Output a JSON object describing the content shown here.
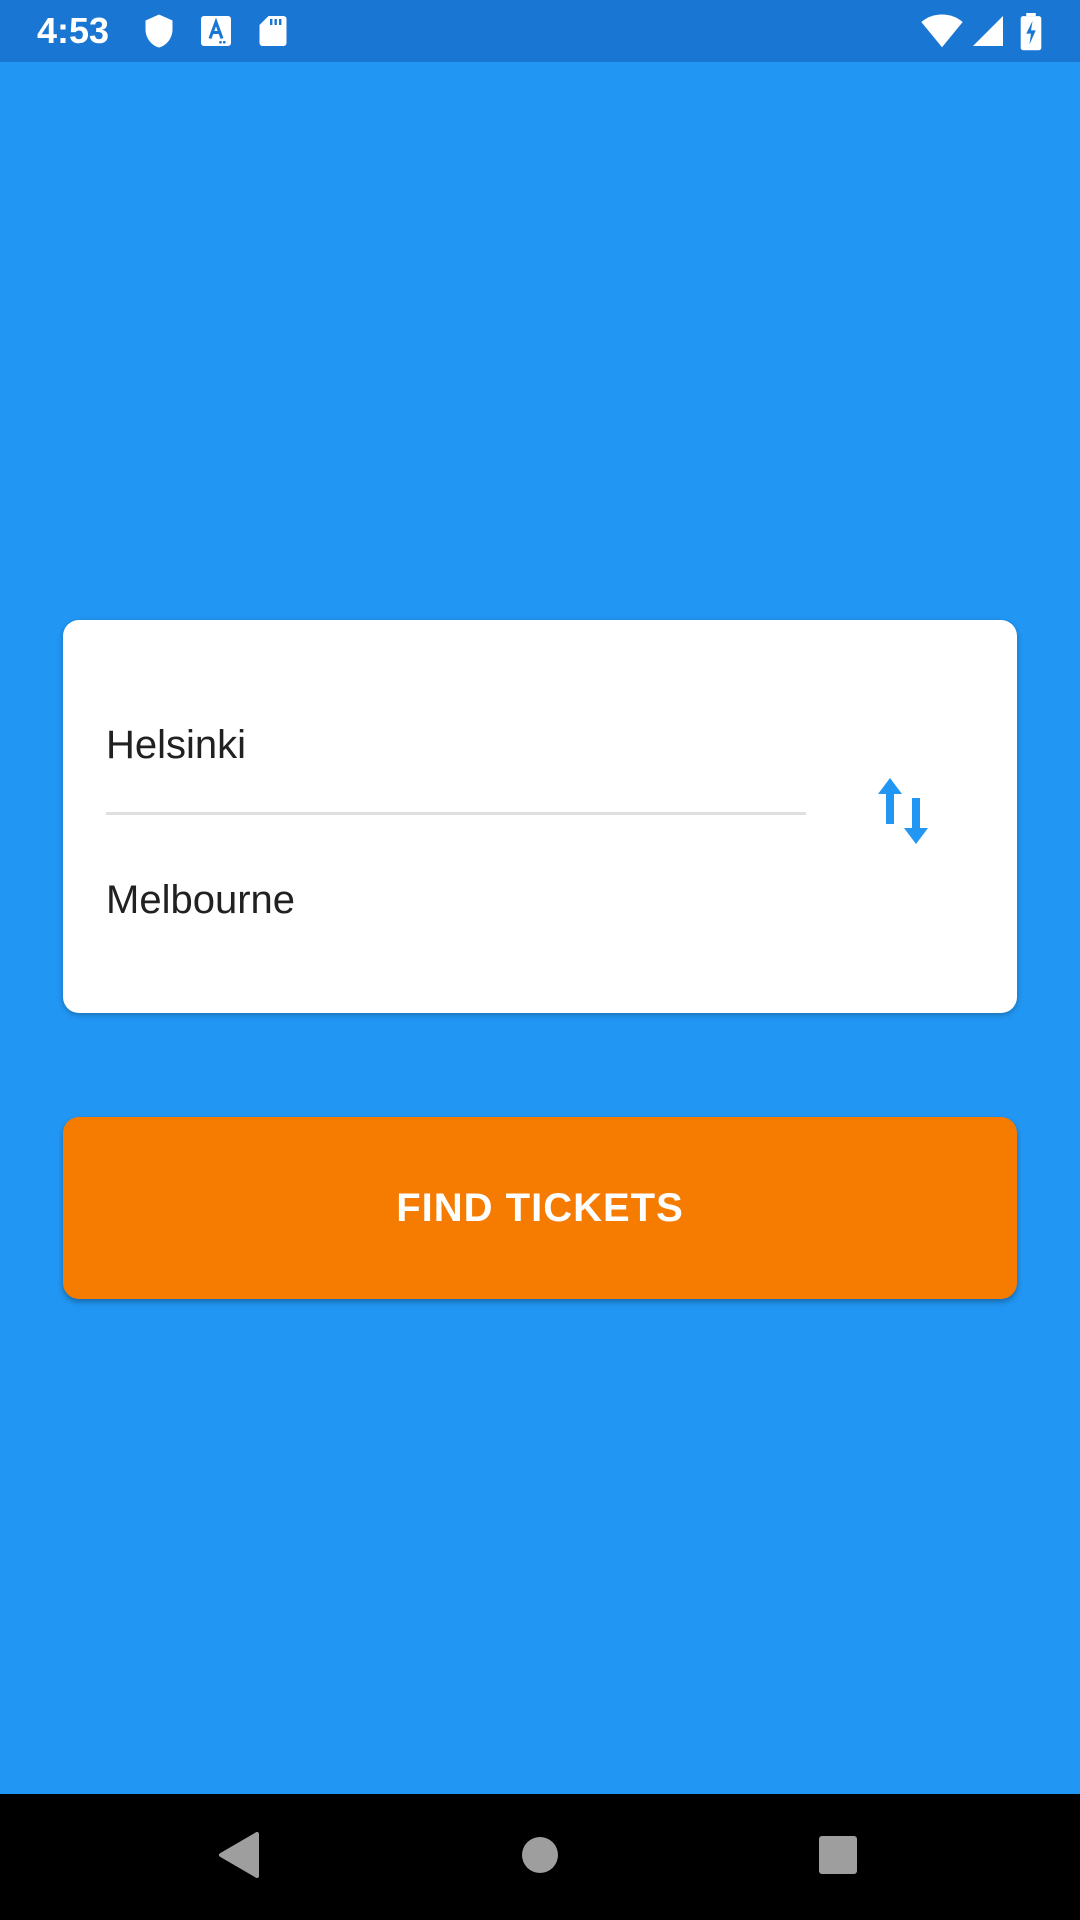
{
  "status_bar": {
    "time": "4:53",
    "left_icons": [
      "shield-icon",
      "font-a-icon",
      "sd-card-icon"
    ],
    "right_icons": [
      "wifi-icon",
      "signal-icon",
      "battery-charging-icon"
    ]
  },
  "route_card": {
    "from_value": "Helsinki",
    "to_value": "Melbourne",
    "swap_icon": "swap-vertical-arrows-icon"
  },
  "actions": {
    "find_label": "FIND TICKETS"
  },
  "nav_bar": {
    "buttons": [
      "back-icon",
      "home-icon",
      "recents-icon"
    ]
  },
  "colors": {
    "background": "#2196F3",
    "status_bar": "#1976D2",
    "card": "#FFFFFF",
    "accent_button": "#F57C00",
    "swap_icon": "#2196F3",
    "nav_bar": "#000000",
    "nav_icons": "#9E9E9E"
  }
}
